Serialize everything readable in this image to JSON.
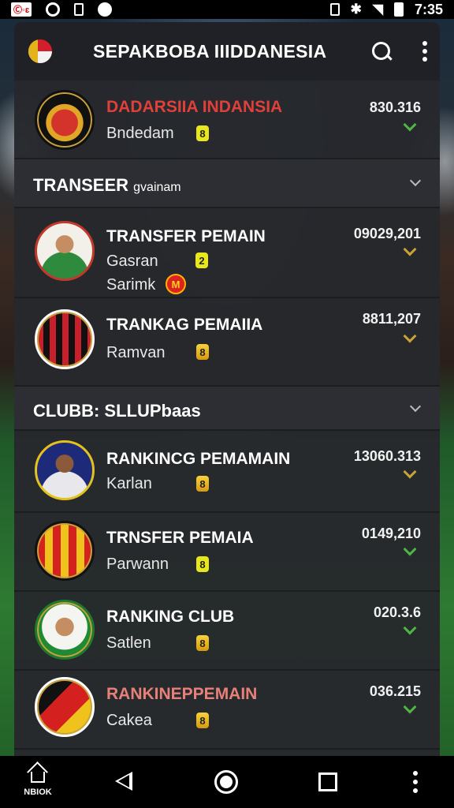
{
  "status_bar": {
    "carrier": "Ⓒ◦ɛ",
    "time": "7:35"
  },
  "app_bar": {
    "title": "SEPAKBOBA IIIDDANESIA"
  },
  "top_item": {
    "title": "DADARSIIA INDANSIA",
    "sub": "Bndedam",
    "badge": "8",
    "value": "830.316"
  },
  "section1": {
    "label": "TRANSEER",
    "label_small": "gvainam"
  },
  "section1_items": [
    {
      "title": "TRANSFER PEMAIN",
      "sub": "Gasran",
      "sub2": "Sarimk",
      "badge": "2",
      "badge2": "M",
      "value": "09029,201"
    },
    {
      "title": "TRANKAG PEMAIIA",
      "sub": "Ramvan",
      "badge": "8",
      "value": "8811,207"
    }
  ],
  "section2": {
    "label": "CLUBB: SLLUPbaas",
    "label_small": ""
  },
  "section2_items": [
    {
      "title": "RANKINCG PEMAMAIN",
      "sub": "Karlan",
      "badge": "8",
      "value": "13060.313"
    },
    {
      "title": "TRNSFER PEMAIA",
      "sub": "Parwann",
      "badge": "8",
      "value": "0149,210"
    },
    {
      "title": "RANKING CLUB",
      "sub": "Satlen",
      "badge": "8",
      "value": "020.3.6"
    },
    {
      "title": "RANKINEPPEMAIN",
      "sub": "Cakea",
      "badge": "8",
      "value": "036.215"
    }
  ],
  "nav": {
    "home_label": "NBIOK"
  },
  "colors": {
    "red_title": "#e0403a",
    "pink_title": "#e8807a",
    "chev_green": "#4fb544",
    "chev_gold": "#c9a23a"
  }
}
